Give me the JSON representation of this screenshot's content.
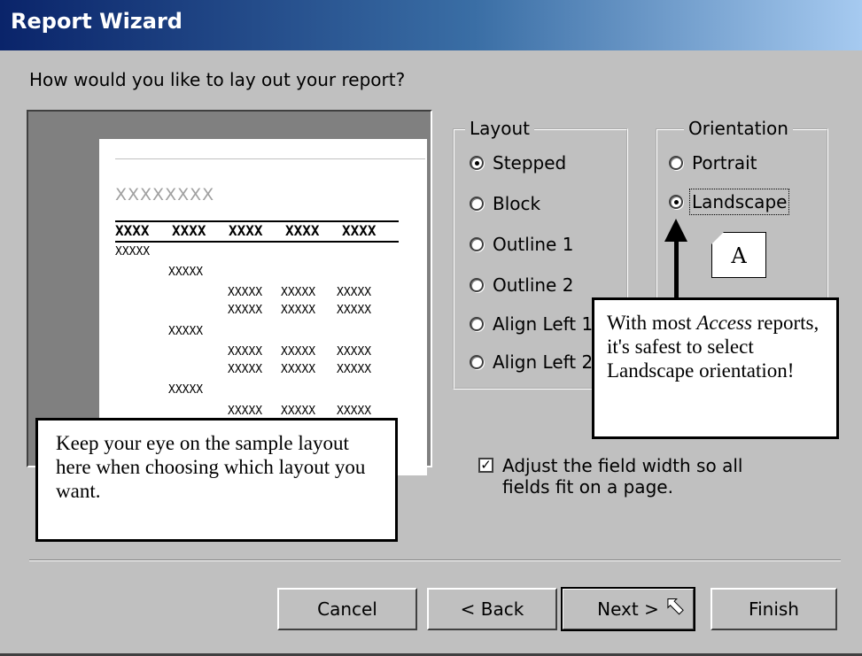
{
  "window": {
    "title": "Report Wizard"
  },
  "prompt": "How would you like to lay out your report?",
  "preview": {
    "title": "XXXXXXXX",
    "headers": [
      "XXXX",
      "XXXX",
      "XXXX",
      "XXXX",
      "XXXX"
    ],
    "cell": "XXXXX"
  },
  "layout": {
    "label": "Layout",
    "options": [
      "Stepped",
      "Block",
      "Outline 1",
      "Outline 2",
      "Align Left 1",
      "Align Left 2"
    ],
    "selected": "Stepped"
  },
  "orientation": {
    "label": "Orientation",
    "options": [
      "Portrait",
      "Landscape"
    ],
    "selected": "Landscape",
    "icon_letter": "A"
  },
  "adjust_checkbox": {
    "label": "Adjust the field width so all fields fit on a page.",
    "checked": true
  },
  "callouts": {
    "orientation_tip_pre": "With most ",
    "orientation_tip_em": "Access",
    "orientation_tip_post": " reports, it's safest to select Landscape orientation!",
    "layout_tip": "Keep your eye on the sample layout here when choosing which layout you want."
  },
  "buttons": {
    "cancel": "Cancel",
    "back": "< Back",
    "next": "Next >",
    "finish": "Finish"
  },
  "colors": {
    "dialog_bg": "#c0c0c0",
    "titlebar_start": "#0a246a",
    "titlebar_end": "#a6caf0"
  }
}
